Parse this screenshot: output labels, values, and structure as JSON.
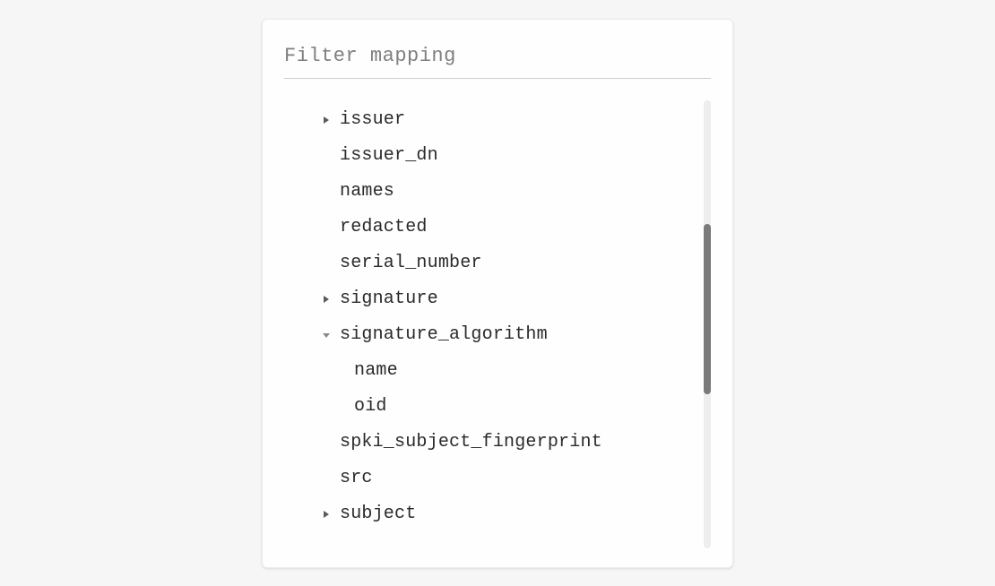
{
  "panel": {
    "title": "Filter mapping"
  },
  "tree": {
    "items": [
      {
        "label": "issuer",
        "expandable": true,
        "expanded": false,
        "level": 0
      },
      {
        "label": "issuer_dn",
        "expandable": false,
        "level": 0
      },
      {
        "label": "names",
        "expandable": false,
        "level": 0
      },
      {
        "label": "redacted",
        "expandable": false,
        "level": 0
      },
      {
        "label": "serial_number",
        "expandable": false,
        "level": 0
      },
      {
        "label": "signature",
        "expandable": true,
        "expanded": false,
        "level": 0
      },
      {
        "label": "signature_algorithm",
        "expandable": true,
        "expanded": true,
        "level": 0
      },
      {
        "label": "name",
        "expandable": false,
        "level": 1
      },
      {
        "label": "oid",
        "expandable": false,
        "level": 1
      },
      {
        "label": "spki_subject_fingerprint",
        "expandable": false,
        "level": 0
      },
      {
        "label": "src",
        "expandable": false,
        "level": 0
      },
      {
        "label": "subject",
        "expandable": true,
        "expanded": false,
        "level": 0
      }
    ]
  }
}
